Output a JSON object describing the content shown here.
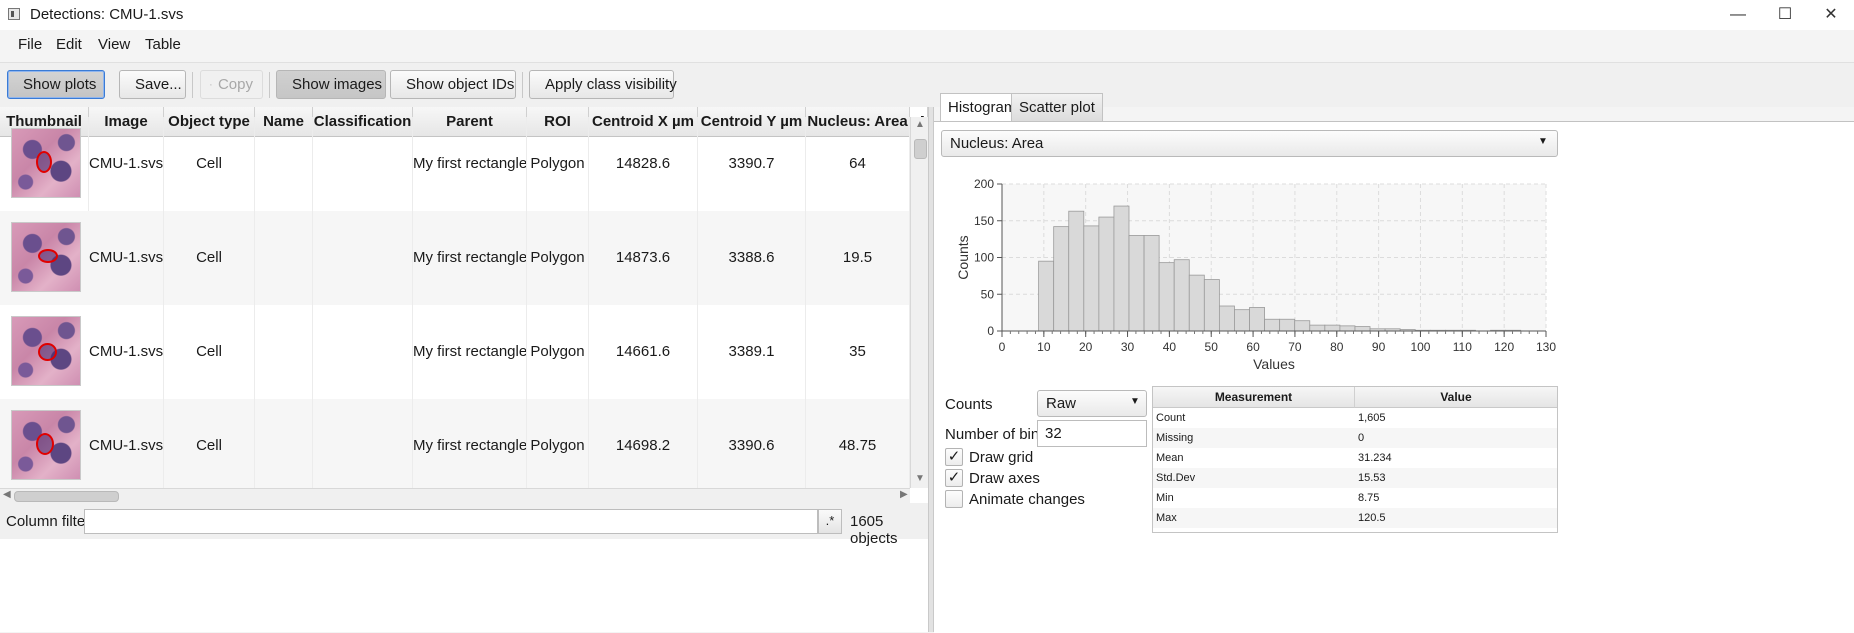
{
  "window": {
    "title": "Detections: CMU-1.svs",
    "controls": [
      "—",
      "☐",
      "✕"
    ]
  },
  "menu": [
    "File",
    "Edit",
    "View",
    "Table"
  ],
  "toolbar": {
    "show_plots": "Show plots",
    "save": "Save...",
    "copy": "Copy",
    "show_images": "Show images",
    "show_object_ids": "Show object IDs",
    "apply_class_visibility": "Apply class visibility"
  },
  "table": {
    "columns": [
      "Thumbnail",
      "Image",
      "Object type",
      "Name",
      "Classification",
      "Parent",
      "ROI",
      "Centroid X µm",
      "Centroid Y µm",
      "Nucleus: Area",
      "N"
    ],
    "rows": [
      {
        "image": "CMU-1.svs",
        "object_type": "Cell",
        "name": "",
        "classification": "",
        "parent": "My first rectangle",
        "roi": "Polygon",
        "cx": "14828.6",
        "cy": "3390.7",
        "area": "64"
      },
      {
        "image": "CMU-1.svs",
        "object_type": "Cell",
        "name": "",
        "classification": "",
        "parent": "My first rectangle",
        "roi": "Polygon",
        "cx": "14873.6",
        "cy": "3388.6",
        "area": "19.5"
      },
      {
        "image": "CMU-1.svs",
        "object_type": "Cell",
        "name": "",
        "classification": "",
        "parent": "My first rectangle",
        "roi": "Polygon",
        "cx": "14661.6",
        "cy": "3389.1",
        "area": "35"
      },
      {
        "image": "CMU-1.svs",
        "object_type": "Cell",
        "name": "",
        "classification": "",
        "parent": "My first rectangle",
        "roi": "Polygon",
        "cx": "14698.2",
        "cy": "3390.6",
        "area": "48.75"
      }
    ]
  },
  "filter": {
    "label": "Column filter",
    "value": "",
    "regex_button": ".*",
    "object_count": "1605 objects"
  },
  "tabs": [
    "Histogram",
    "Scatter plot"
  ],
  "measurement_select": "Nucleus: Area",
  "chart_data": {
    "type": "bar",
    "xlabel": "Values",
    "ylabel": "Counts",
    "xlim": [
      0,
      130
    ],
    "ylim": [
      0,
      200
    ],
    "x_ticks": [
      0,
      10,
      20,
      30,
      40,
      50,
      60,
      70,
      80,
      90,
      100,
      110,
      120,
      130
    ],
    "y_ticks": [
      0,
      50,
      100,
      150,
      200
    ],
    "grid": true,
    "bin_start": 8.75,
    "bin_width": 3.6,
    "values": [
      95,
      142,
      163,
      143,
      155,
      170,
      130,
      130,
      93,
      97,
      76,
      70,
      34,
      29,
      32,
      16,
      16,
      14,
      8,
      8,
      7,
      6,
      3,
      3,
      2,
      1,
      1,
      1,
      1,
      0,
      1,
      1
    ]
  },
  "controls": {
    "counts_label": "Counts",
    "counts_value": "Raw",
    "bins_label": "Number of bins",
    "bins_value": "32",
    "draw_grid_label": "Draw grid",
    "draw_grid_checked": true,
    "draw_axes_label": "Draw axes",
    "draw_axes_checked": true,
    "animate_label": "Animate changes",
    "animate_checked": false
  },
  "stats": {
    "headers": [
      "Measurement",
      "Value"
    ],
    "rows": [
      {
        "m": "Count",
        "v": "1,605"
      },
      {
        "m": "Missing",
        "v": "0"
      },
      {
        "m": "Mean",
        "v": "31.234"
      },
      {
        "m": "Std.Dev",
        "v": "15.53"
      },
      {
        "m": "Min",
        "v": "8.75"
      },
      {
        "m": "Max",
        "v": "120.5"
      }
    ]
  },
  "colors": {
    "accent": "#3a7bd5",
    "bar_fill": "#d9d9d9",
    "bar_stroke": "#9a9a9a",
    "nucleus_outline": "#e00000"
  }
}
